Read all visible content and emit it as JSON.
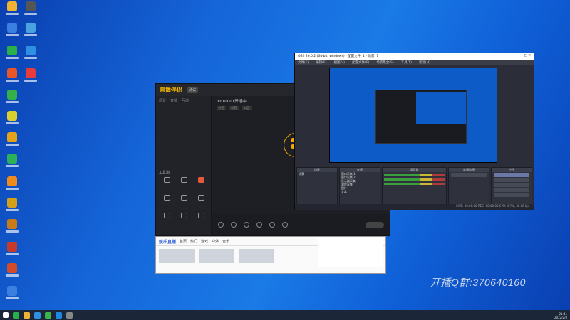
{
  "desktop": {
    "icons": [
      "app-1",
      "app-2",
      "app-3",
      "app-4",
      "app-5",
      "app-6",
      "app-7",
      "app-8",
      "app-9",
      "app-10",
      "app-11",
      "app-12",
      "app-13",
      "app-14",
      "app-15",
      "app-16",
      "app-17",
      "app-18",
      "app-19",
      "app-20",
      "app-21",
      "app-22",
      "app-23"
    ],
    "watermark": "开播Q群:370640160"
  },
  "stream_app": {
    "logo": "直播伴侣",
    "badge": "测试",
    "tabs": [
      "场景",
      "直播",
      "互动"
    ],
    "room_title": "ID:10001开播中",
    "room_tags": [
      "分区",
      "标签",
      "公告"
    ],
    "tools_label": "工具箱"
  },
  "browser": {
    "logo": "娱乐直播",
    "nav": [
      "首页",
      "热门",
      "游戏",
      "户外",
      "音乐"
    ]
  },
  "obs": {
    "title": "OBS 26.0.2 (64-bit, windows) - 配置文件: 1 - 场景: 1",
    "menu": [
      "文件(F)",
      "编辑(E)",
      "视图(V)",
      "配置文件(P)",
      "场景集合(S)",
      "工具(T)",
      "帮助(H)"
    ],
    "docks": [
      "场景",
      "来源",
      "混音器",
      "转场动画",
      "控件"
    ],
    "scenes": [
      "场景"
    ],
    "sources": [
      "窗口采集 1",
      "窗口采集 2",
      "显示器采集",
      "游戏采集",
      "图片",
      "文本"
    ],
    "controls": [
      "开始推流",
      "开始录制",
      "工作室模式",
      "设置",
      "退出"
    ],
    "status": "LIVE: 00:00:00  REC: 00:00:00  CPU: 4.7%, 30.00 fps"
  },
  "taskbar": {
    "time": "21:41",
    "date": "2022/2/8"
  }
}
